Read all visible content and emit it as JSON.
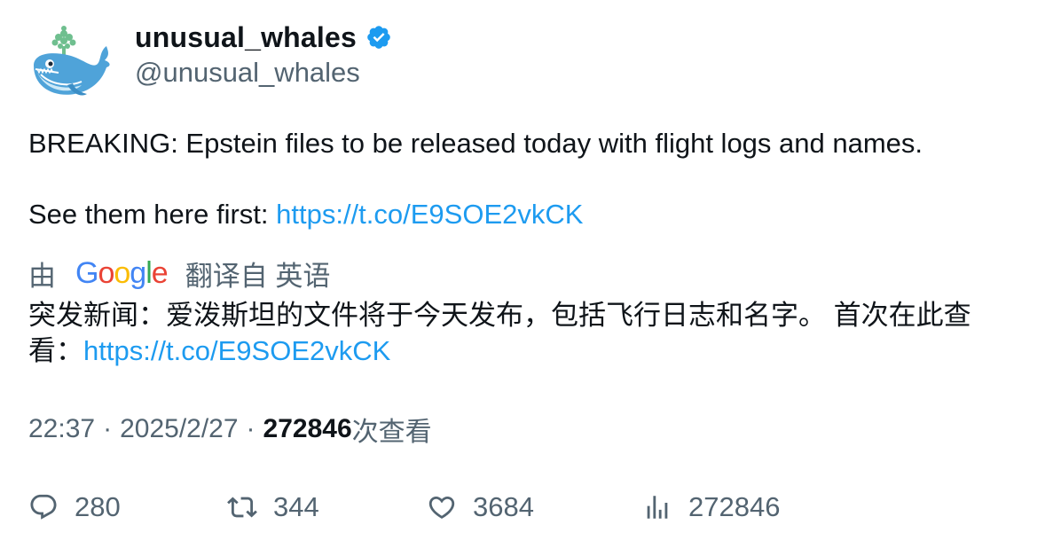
{
  "author": {
    "display_name": "unusual_whales",
    "handle": "@unusual_whales",
    "verified": true,
    "avatar_icon": "whale-icon"
  },
  "tweet": {
    "line1": "BREAKING: Epstein files to be released today with flight logs and names.",
    "line2_prefix": "See them here first: ",
    "line2_link": "https://t.co/E9SOE2vkCK"
  },
  "translation": {
    "by_label": "由",
    "google_letters": [
      "G",
      "o",
      "o",
      "g",
      "l",
      "e"
    ],
    "google_colors": [
      "#4285F4",
      "#EA4335",
      "#FBBC05",
      "#4285F4",
      "#34A853",
      "#EA4335"
    ],
    "translated_from": "翻译自 英语",
    "line1": "突发新闻：爱泼斯坦的文件将于今天发布，包括飞行日志和名字。 首次在此查",
    "line2_prefix": "看：",
    "line2_link": "https://t.co/E9SOE2vkCK"
  },
  "meta": {
    "time": "22:37",
    "separator": "·",
    "date": "2025/2/27",
    "views_count": "272846",
    "views_label": "次查看"
  },
  "actions": {
    "replies": "280",
    "reposts": "344",
    "likes": "3684",
    "views": "272846"
  },
  "colors": {
    "link": "#1d9bf0",
    "muted": "#536471",
    "text": "#0f1419",
    "verified": "#1d9bf0"
  }
}
